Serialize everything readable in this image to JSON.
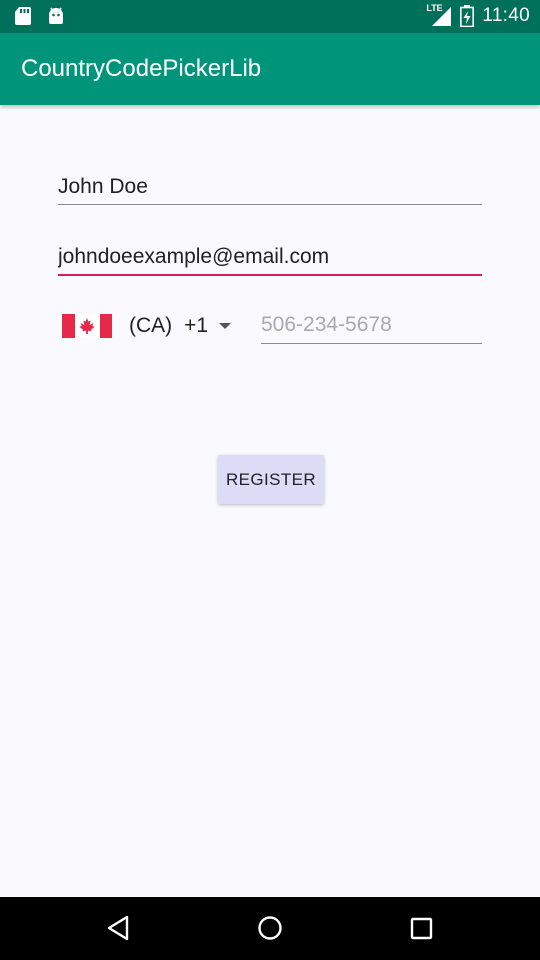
{
  "status_bar": {
    "time": "11:40",
    "network_label": "LTE",
    "icons": [
      "sd-card-icon",
      "android-icon",
      "signal-icon",
      "battery-icon"
    ]
  },
  "app_bar": {
    "title": "CountryCodePickerLib"
  },
  "form": {
    "name_value": "John Doe",
    "email_value": "johndoeexample@email.com",
    "country_picker": {
      "flag": "canada-flag",
      "country_code": "(CA)",
      "dial_code": "+1"
    },
    "phone_placeholder": "506-234-5678",
    "register_label": "REGISTER"
  },
  "colors": {
    "status_bar": "#00705a",
    "app_bar": "#00957a",
    "accent": "#d81b60",
    "button": "#dcdcf6",
    "background": "#fafafe"
  },
  "nav_bar": {
    "icons": [
      "back-icon",
      "home-icon",
      "recents-icon"
    ]
  }
}
